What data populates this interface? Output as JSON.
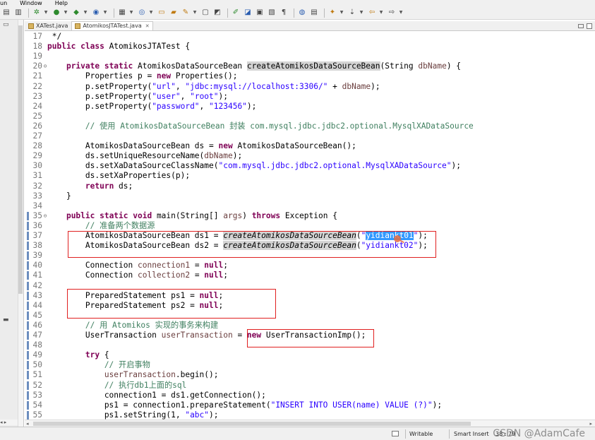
{
  "menu": {
    "items": [
      "un",
      "Window",
      "Help"
    ]
  },
  "tabs": [
    {
      "label": "XATest.java",
      "active": false
    },
    {
      "label": "AtomikosJTATest.java",
      "active": true
    }
  ],
  "editor": {
    "lines": [
      {
        "n": "17",
        "t": [
          [
            "",
            " */"
          ]
        ]
      },
      {
        "n": "18",
        "t": [
          [
            "kw",
            "public class"
          ],
          [
            "",
            " AtomikosJTATest {"
          ]
        ]
      },
      {
        "n": "19",
        "t": []
      },
      {
        "n": "20",
        "fold": "⊖",
        "t": [
          [
            "",
            "    "
          ],
          [
            "kw",
            "private static"
          ],
          [
            "",
            " AtomikosDataSourceBean "
          ],
          [
            "hl",
            "createAtomikosDataSourceBean"
          ],
          [
            "",
            "(String "
          ],
          [
            "par",
            "dbName"
          ],
          [
            "",
            ") {"
          ]
        ]
      },
      {
        "n": "21",
        "t": [
          [
            "",
            "        Properties p = "
          ],
          [
            "kw",
            "new"
          ],
          [
            "",
            " Properties();"
          ]
        ]
      },
      {
        "n": "22",
        "t": [
          [
            "",
            "        p.setProperty("
          ],
          [
            "str",
            "\"url\""
          ],
          [
            "",
            ", "
          ],
          [
            "str",
            "\"jdbc:mysql://localhost:3306/\""
          ],
          [
            "",
            " + "
          ],
          [
            "par",
            "dbName"
          ],
          [
            "",
            ");"
          ]
        ]
      },
      {
        "n": "23",
        "t": [
          [
            "",
            "        p.setProperty("
          ],
          [
            "str",
            "\"user\""
          ],
          [
            "",
            ", "
          ],
          [
            "str",
            "\"root\""
          ],
          [
            "",
            ");"
          ]
        ]
      },
      {
        "n": "24",
        "t": [
          [
            "",
            "        p.setProperty("
          ],
          [
            "str",
            "\"password\""
          ],
          [
            "",
            ", "
          ],
          [
            "str",
            "\"123456\""
          ],
          [
            "",
            ");"
          ]
        ]
      },
      {
        "n": "25",
        "t": []
      },
      {
        "n": "26",
        "t": [
          [
            "cm",
            "        // 使用 AtomikosDataSourceBean 封装 com.mysql.jdbc.jdbc2.optional.MysqlXADataSource"
          ]
        ]
      },
      {
        "n": "27",
        "t": []
      },
      {
        "n": "28",
        "t": [
          [
            "",
            "        AtomikosDataSourceBean ds = "
          ],
          [
            "kw",
            "new"
          ],
          [
            "",
            " AtomikosDataSourceBean();"
          ]
        ]
      },
      {
        "n": "29",
        "t": [
          [
            "",
            "        ds.setUniqueResourceName("
          ],
          [
            "par",
            "dbName"
          ],
          [
            "",
            ");"
          ]
        ]
      },
      {
        "n": "30",
        "t": [
          [
            "",
            "        ds.setXaDataSourceClassName("
          ],
          [
            "str",
            "\"com.mysql.jdbc.jdbc2.optional.MysqlXADataSource\""
          ],
          [
            "",
            ");"
          ]
        ]
      },
      {
        "n": "31",
        "t": [
          [
            "",
            "        ds.setXaProperties(p);"
          ]
        ]
      },
      {
        "n": "32",
        "t": [
          [
            "",
            "        "
          ],
          [
            "kw",
            "return"
          ],
          [
            "",
            " ds;"
          ]
        ]
      },
      {
        "n": "33",
        "t": [
          [
            "",
            "    }"
          ]
        ]
      },
      {
        "n": "34",
        "t": []
      },
      {
        "n": "35",
        "fold": "⊖",
        "marker": true,
        "t": [
          [
            "",
            "    "
          ],
          [
            "kw",
            "public static void"
          ],
          [
            "",
            " main(String[] "
          ],
          [
            "par",
            "args"
          ],
          [
            "",
            ") "
          ],
          [
            "kw",
            "throws"
          ],
          [
            "",
            " Exception {"
          ]
        ]
      },
      {
        "n": "36",
        "marker": true,
        "t": [
          [
            "cm",
            "        // 准备两个数据源"
          ]
        ]
      },
      {
        "n": "37",
        "marker": true,
        "t": [
          [
            "",
            "        AtomikosDataSourceBean ds1 = "
          ],
          [
            "it hl",
            "createAtomikosDataSourceBean"
          ],
          [
            "",
            "("
          ],
          [
            "str",
            "\""
          ],
          [
            "sel",
            "yidiankt01"
          ],
          [
            "str",
            "\""
          ],
          [
            "",
            ");"
          ]
        ]
      },
      {
        "n": "38",
        "marker": true,
        "t": [
          [
            "",
            "        AtomikosDataSourceBean ds2 = "
          ],
          [
            "it hl",
            "createAtomikosDataSourceBean"
          ],
          [
            "",
            "("
          ],
          [
            "str",
            "\"yidiankt02\""
          ],
          [
            "",
            ");"
          ]
        ]
      },
      {
        "n": "39",
        "marker": true,
        "t": []
      },
      {
        "n": "40",
        "marker": true,
        "t": [
          [
            "",
            "        Connection "
          ],
          [
            "par",
            "connection1"
          ],
          [
            "",
            " = "
          ],
          [
            "kw",
            "null"
          ],
          [
            "",
            ";"
          ]
        ]
      },
      {
        "n": "41",
        "marker": true,
        "t": [
          [
            "",
            "        Connection "
          ],
          [
            "par",
            "collection2"
          ],
          [
            "",
            " = "
          ],
          [
            "kw",
            "null"
          ],
          [
            "",
            ";"
          ]
        ]
      },
      {
        "n": "42",
        "marker": true,
        "t": []
      },
      {
        "n": "43",
        "marker": true,
        "t": [
          [
            "",
            "        PreparedStatement ps1 = "
          ],
          [
            "kw",
            "null"
          ],
          [
            "",
            ";"
          ]
        ]
      },
      {
        "n": "44",
        "marker": true,
        "t": [
          [
            "",
            "        PreparedStatement ps2 = "
          ],
          [
            "kw",
            "null"
          ],
          [
            "",
            ";"
          ]
        ]
      },
      {
        "n": "45",
        "marker": true,
        "t": []
      },
      {
        "n": "46",
        "marker": true,
        "t": [
          [
            "cm",
            "        // 用 Atomikos 实现的事务来构建"
          ]
        ]
      },
      {
        "n": "47",
        "marker": true,
        "t": [
          [
            "",
            "        UserTransaction "
          ],
          [
            "par",
            "userTransaction"
          ],
          [
            "",
            " = "
          ],
          [
            "kw",
            "new"
          ],
          [
            "",
            " UserTransactionImp();"
          ]
        ]
      },
      {
        "n": "48",
        "marker": true,
        "t": []
      },
      {
        "n": "49",
        "marker": true,
        "t": [
          [
            "",
            "        "
          ],
          [
            "kw",
            "try"
          ],
          [
            "",
            " {"
          ]
        ]
      },
      {
        "n": "50",
        "marker": true,
        "t": [
          [
            "cm",
            "            // 开启事物"
          ]
        ]
      },
      {
        "n": "51",
        "marker": true,
        "t": [
          [
            "",
            "            "
          ],
          [
            "par",
            "userTransaction"
          ],
          [
            "",
            ".begin();"
          ]
        ]
      },
      {
        "n": "52",
        "marker": true,
        "t": [
          [
            "cm",
            "            // 执行db1上面的sql"
          ]
        ]
      },
      {
        "n": "53",
        "marker": true,
        "t": [
          [
            "",
            "            connection1 = ds1.getConnection();"
          ]
        ]
      },
      {
        "n": "54",
        "marker": true,
        "t": [
          [
            "",
            "            ps1 = connection1.prepareStatement("
          ],
          [
            "str",
            "\"INSERT INTO USER(name) VALUE (?)\""
          ],
          [
            "",
            ");"
          ]
        ]
      },
      {
        "n": "55",
        "marker": true,
        "t": [
          [
            "",
            "            ps1.setString(1, "
          ],
          [
            "str",
            "\"abc\""
          ],
          [
            "",
            ");"
          ]
        ]
      }
    ]
  },
  "status": {
    "writable": "Writable",
    "insert_mode": "Smart Insert",
    "position": "38 : 79"
  },
  "watermark": "CSDN @AdamCafe"
}
